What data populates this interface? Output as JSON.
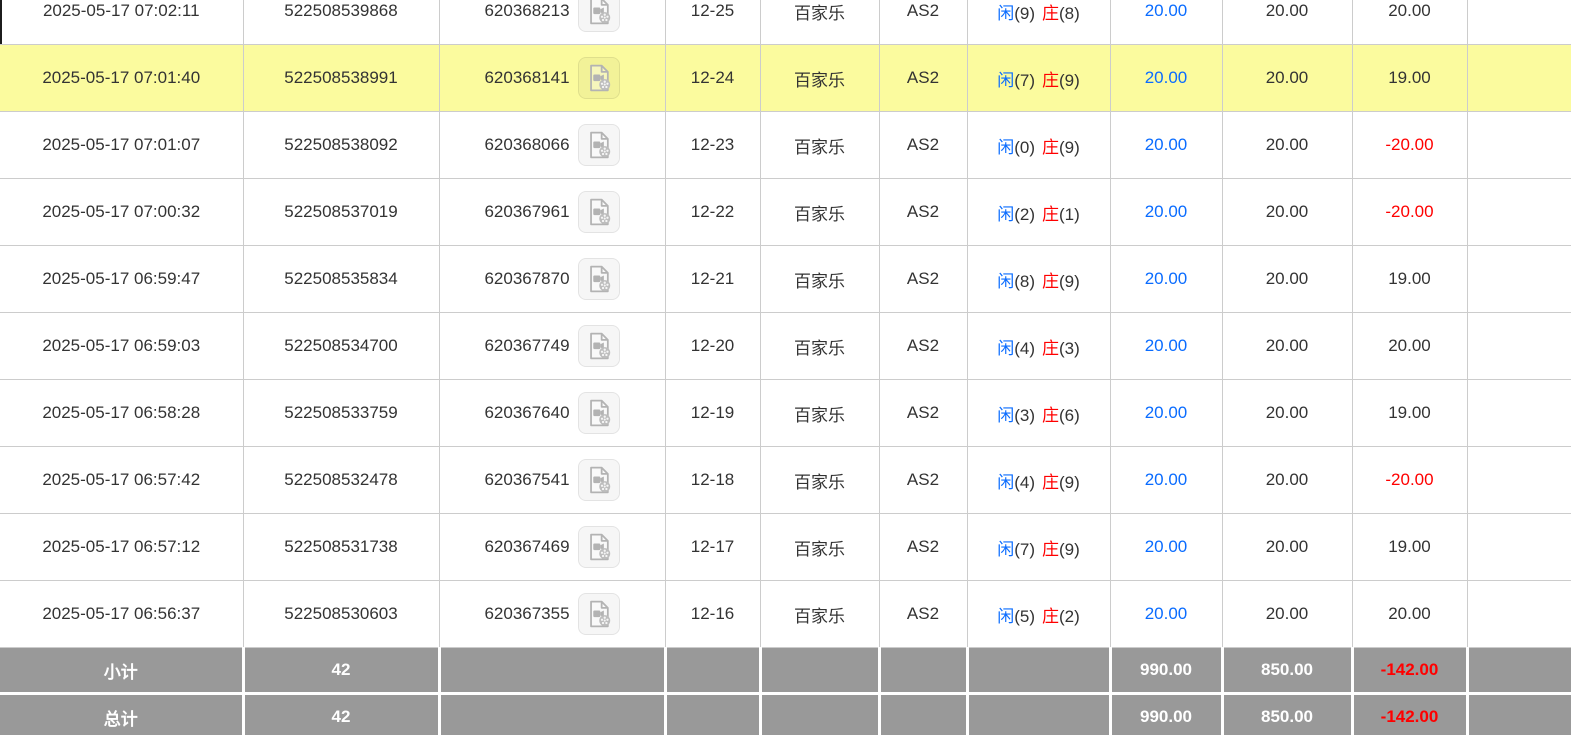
{
  "colors": {
    "highlight_row": "#fbfb9e",
    "link_blue": "#0a6cff",
    "player_blue": "#0a6cff",
    "banker_red": "#ff0000",
    "negative_red": "#ff0000",
    "totals_bg": "#999999",
    "totals_text": "#ffffff",
    "row_border": "#cccccc"
  },
  "icons": {
    "video": "video-file-icon"
  },
  "table": {
    "rows": [
      {
        "time": "2025-05-17 07:02:11",
        "bet_id": "522508539868",
        "round_id": "620368213",
        "round_no": "12-25",
        "game": "百家乐",
        "table": "AS2",
        "player_char": "闲",
        "player_score": "(9)",
        "banker_char": "庄",
        "banker_score": "(8)",
        "bet_amount": "20.00",
        "valid_amount": "20.00",
        "win_loss": "20.00",
        "highlighted": false
      },
      {
        "time": "2025-05-17 07:01:40",
        "bet_id": "522508538991",
        "round_id": "620368141",
        "round_no": "12-24",
        "game": "百家乐",
        "table": "AS2",
        "player_char": "闲",
        "player_score": "(7)",
        "banker_char": "庄",
        "banker_score": "(9)",
        "bet_amount": "20.00",
        "valid_amount": "20.00",
        "win_loss": "19.00",
        "highlighted": true
      },
      {
        "time": "2025-05-17 07:01:07",
        "bet_id": "522508538092",
        "round_id": "620368066",
        "round_no": "12-23",
        "game": "百家乐",
        "table": "AS2",
        "player_char": "闲",
        "player_score": "(0)",
        "banker_char": "庄",
        "banker_score": "(9)",
        "bet_amount": "20.00",
        "valid_amount": "20.00",
        "win_loss": "-20.00",
        "highlighted": false
      },
      {
        "time": "2025-05-17 07:00:32",
        "bet_id": "522508537019",
        "round_id": "620367961",
        "round_no": "12-22",
        "game": "百家乐",
        "table": "AS2",
        "player_char": "闲",
        "player_score": "(2)",
        "banker_char": "庄",
        "banker_score": "(1)",
        "bet_amount": "20.00",
        "valid_amount": "20.00",
        "win_loss": "-20.00",
        "highlighted": false
      },
      {
        "time": "2025-05-17 06:59:47",
        "bet_id": "522508535834",
        "round_id": "620367870",
        "round_no": "12-21",
        "game": "百家乐",
        "table": "AS2",
        "player_char": "闲",
        "player_score": "(8)",
        "banker_char": "庄",
        "banker_score": "(9)",
        "bet_amount": "20.00",
        "valid_amount": "20.00",
        "win_loss": "19.00",
        "highlighted": false
      },
      {
        "time": "2025-05-17 06:59:03",
        "bet_id": "522508534700",
        "round_id": "620367749",
        "round_no": "12-20",
        "game": "百家乐",
        "table": "AS2",
        "player_char": "闲",
        "player_score": "(4)",
        "banker_char": "庄",
        "banker_score": "(3)",
        "bet_amount": "20.00",
        "valid_amount": "20.00",
        "win_loss": "20.00",
        "highlighted": false
      },
      {
        "time": "2025-05-17 06:58:28",
        "bet_id": "522508533759",
        "round_id": "620367640",
        "round_no": "12-19",
        "game": "百家乐",
        "table": "AS2",
        "player_char": "闲",
        "player_score": "(3)",
        "banker_char": "庄",
        "banker_score": "(6)",
        "bet_amount": "20.00",
        "valid_amount": "20.00",
        "win_loss": "19.00",
        "highlighted": false
      },
      {
        "time": "2025-05-17 06:57:42",
        "bet_id": "522508532478",
        "round_id": "620367541",
        "round_no": "12-18",
        "game": "百家乐",
        "table": "AS2",
        "player_char": "闲",
        "player_score": "(4)",
        "banker_char": "庄",
        "banker_score": "(9)",
        "bet_amount": "20.00",
        "valid_amount": "20.00",
        "win_loss": "-20.00",
        "highlighted": false
      },
      {
        "time": "2025-05-17 06:57:12",
        "bet_id": "522508531738",
        "round_id": "620367469",
        "round_no": "12-17",
        "game": "百家乐",
        "table": "AS2",
        "player_char": "闲",
        "player_score": "(7)",
        "banker_char": "庄",
        "banker_score": "(9)",
        "bet_amount": "20.00",
        "valid_amount": "20.00",
        "win_loss": "19.00",
        "highlighted": false
      },
      {
        "time": "2025-05-17 06:56:37",
        "bet_id": "522508530603",
        "round_id": "620367355",
        "round_no": "12-16",
        "game": "百家乐",
        "table": "AS2",
        "player_char": "闲",
        "player_score": "(5)",
        "banker_char": "庄",
        "banker_score": "(2)",
        "bet_amount": "20.00",
        "valid_amount": "20.00",
        "win_loss": "20.00",
        "highlighted": false
      }
    ],
    "subtotal": {
      "label": "小计",
      "count": "42",
      "bet_total": "990.00",
      "valid_total": "850.00",
      "win_loss_total": "-142.00"
    },
    "grand_total": {
      "label": "总计",
      "count": "42",
      "bet_total": "990.00",
      "valid_total": "850.00",
      "win_loss_total": "-142.00"
    }
  }
}
